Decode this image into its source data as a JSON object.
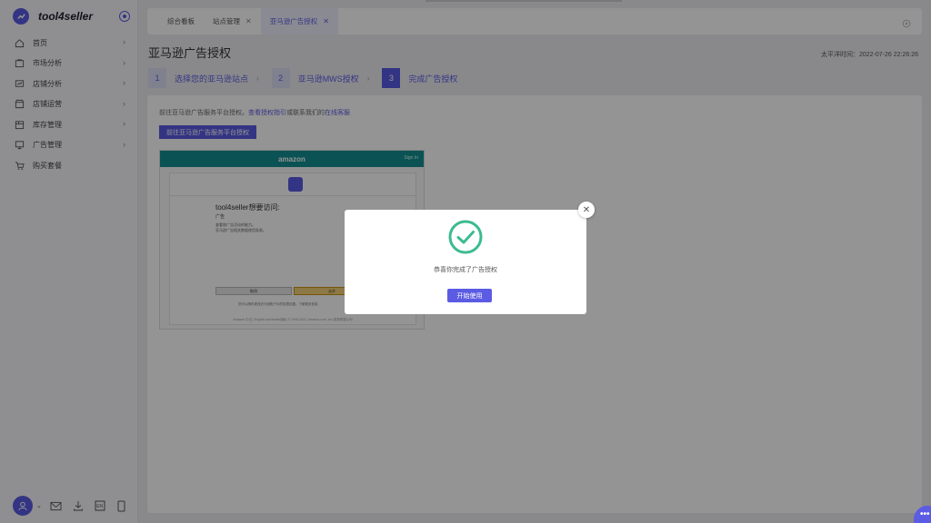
{
  "sidebar": {
    "brand": "tool4seller",
    "items": [
      {
        "label": "首页",
        "icon": "home-icon",
        "has_arrow": true
      },
      {
        "label": "市场分析",
        "icon": "shopping-bag-icon",
        "has_arrow": true
      },
      {
        "label": "店铺分析",
        "icon": "chart-board-icon",
        "has_arrow": true
      },
      {
        "label": "店铺运营",
        "icon": "store-icon",
        "has_arrow": true
      },
      {
        "label": "库存管理",
        "icon": "box-icon",
        "has_arrow": true
      },
      {
        "label": "广告管理",
        "icon": "monitor-icon",
        "has_arrow": true
      },
      {
        "label": "购买套餐",
        "icon": "cart-icon",
        "has_arrow": false
      }
    ],
    "bottom_icons": [
      "mail-icon",
      "download-icon",
      "language-icon",
      "mobile-icon"
    ]
  },
  "tabs": [
    {
      "label": "综合看板",
      "closable": false,
      "active": false
    },
    {
      "label": "站点管理",
      "closable": true,
      "active": false
    },
    {
      "label": "亚马逊广告授权",
      "closable": true,
      "active": true
    }
  ],
  "page": {
    "title": "亚马逊广告授权",
    "time_label": "太平洋时间：2022-07-26 22:26:26"
  },
  "steps": [
    {
      "num": "1",
      "label": "选择您的亚马逊站点"
    },
    {
      "num": "2",
      "label": "亚马逊MWS授权"
    },
    {
      "num": "3",
      "label": "完成广告授权"
    }
  ],
  "content": {
    "hint_prefix": "前往亚马逊广告服务平台授权。",
    "hint_link1": "查看授权指引",
    "hint_middle": "或联系我们的",
    "hint_link2": "在线客服",
    "go_button": "前往亚马逊广告服务平台授权"
  },
  "amazon_preview": {
    "logo": "amazon",
    "signin": "Sign In",
    "request": "tool4seller想要访问:",
    "scope": "广告",
    "desc_line1": "查看和广告活动的能力。",
    "desc_line2": "亚马逊广告相关数据使用条款。",
    "cancel": "取消",
    "allow": "允许",
    "note": "您可以随时更改亚马逊账户中的权限设置。了解更多信息",
    "footer": "Amazon 中文 | English tool4seller隐私 © 1996-2022, Amazon.com, Inc.或其附属公司"
  },
  "modal": {
    "message": "恭喜你完成了广告授权",
    "button": "开始使用",
    "accent": "#3cba92"
  }
}
